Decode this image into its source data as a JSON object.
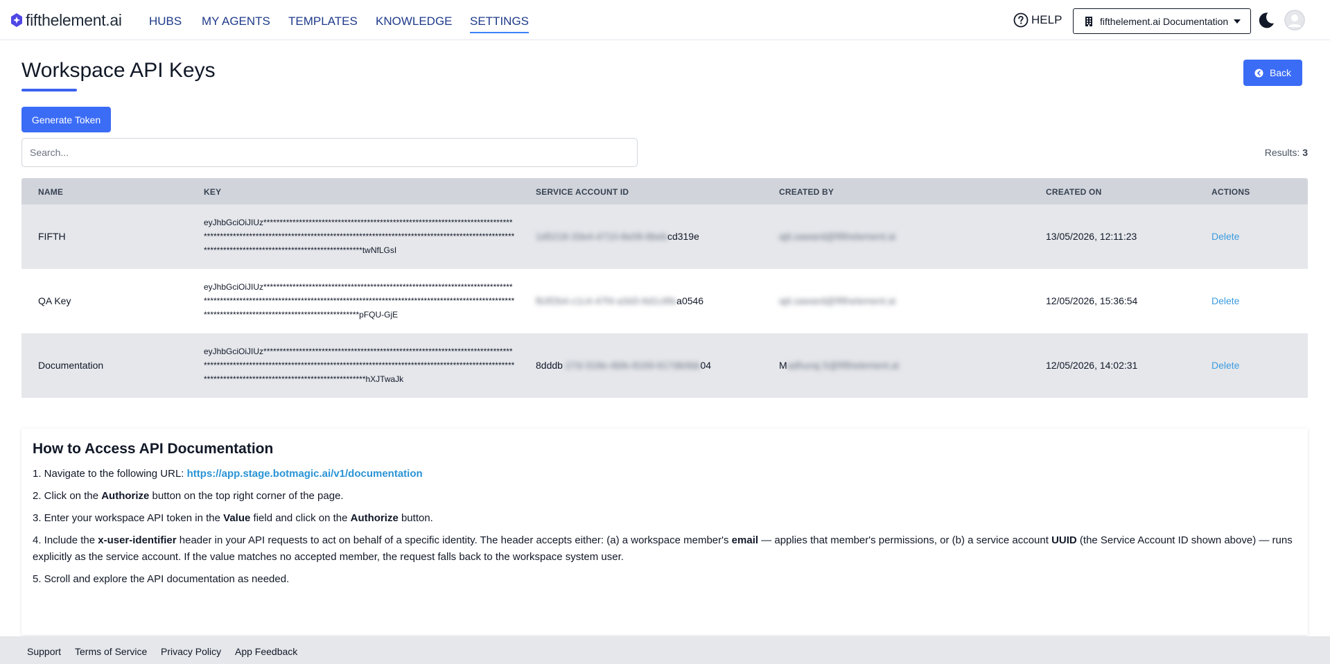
{
  "brand": {
    "name": "fifthelement.ai",
    "accent": "#3b6cf6"
  },
  "nav": {
    "items": [
      {
        "label": "HUBS"
      },
      {
        "label": "MY AGENTS"
      },
      {
        "label": "TEMPLATES"
      },
      {
        "label": "KNOWLEDGE"
      },
      {
        "label": "SETTINGS",
        "active": true
      }
    ],
    "help_label": "HELP",
    "workspace_label": "fifthelement.ai Documentation"
  },
  "page": {
    "title": "Workspace API Keys",
    "back_label": "Back",
    "generate_label": "Generate Token",
    "search_placeholder": "Search...",
    "results_label": "Results:",
    "results_count": "3"
  },
  "table": {
    "headers": {
      "name": "NAME",
      "key": "KEY",
      "service_account_id": "SERVICE ACCOUNT ID",
      "created_by": "CREATED BY",
      "created_on": "CREATED ON",
      "actions": "ACTIONS"
    },
    "rows": [
      {
        "name": "FIFTH",
        "key": "eyJhbGciOiJIUz******************************************************************************************************************************************************************************************************************************twNfLGsI",
        "service_visible": "cd319e",
        "created_by_visible": "",
        "created_on": "13/05/2026, 12:11:23",
        "action": "Delete"
      },
      {
        "name": "QA Key",
        "key": "eyJhbGciOiJIUz*****************************************************************************************************************************************************************************************************************************pFQU-GjE",
        "service_visible": "a0546",
        "created_by_visible": "",
        "created_on": "12/05/2026, 15:36:54",
        "action": "Delete"
      },
      {
        "name": "Documentation",
        "key": "eyJhbGciOiJIUz*******************************************************************************************************************************************************************************************************************************hXJTwaJk",
        "service_visible_start": "8dddb",
        "service_visible_end": "04",
        "created_by_visible": "M",
        "created_on": "12/05/2026, 14:02:31",
        "action": "Delete"
      }
    ]
  },
  "docs": {
    "title": "How to Access API Documentation",
    "step1_prefix": "1. Navigate to the following URL: ",
    "step1_url": "https://app.stage.botmagic.ai/v1/documentation",
    "step2_a": "2. Click on the ",
    "step2_b": "Authorize",
    "step2_c": " button on the top right corner of the page.",
    "step3_a": "3. Enter your workspace API token in the ",
    "step3_b": "Value",
    "step3_c": " field and click on the ",
    "step3_d": "Authorize",
    "step3_e": " button.",
    "step4_a": "4. Include the ",
    "step4_b": "x-user-identifier",
    "step4_c": " header in your API requests to act on behalf of a specific identity. The header accepts either: (a) a workspace member's ",
    "step4_d": "email",
    "step4_e": " — applies that member's permissions, or (b) a service account ",
    "step4_f": "UUID",
    "step4_g": " (the Service Account ID shown above) — runs explicitly as the service account. If the value matches no accepted member, the request falls back to the workspace system user.",
    "step5": "5. Scroll and explore the API documentation as needed."
  },
  "footer": {
    "links": [
      "Support",
      "Terms of Service",
      "Privacy Policy",
      "App Feedback"
    ]
  }
}
